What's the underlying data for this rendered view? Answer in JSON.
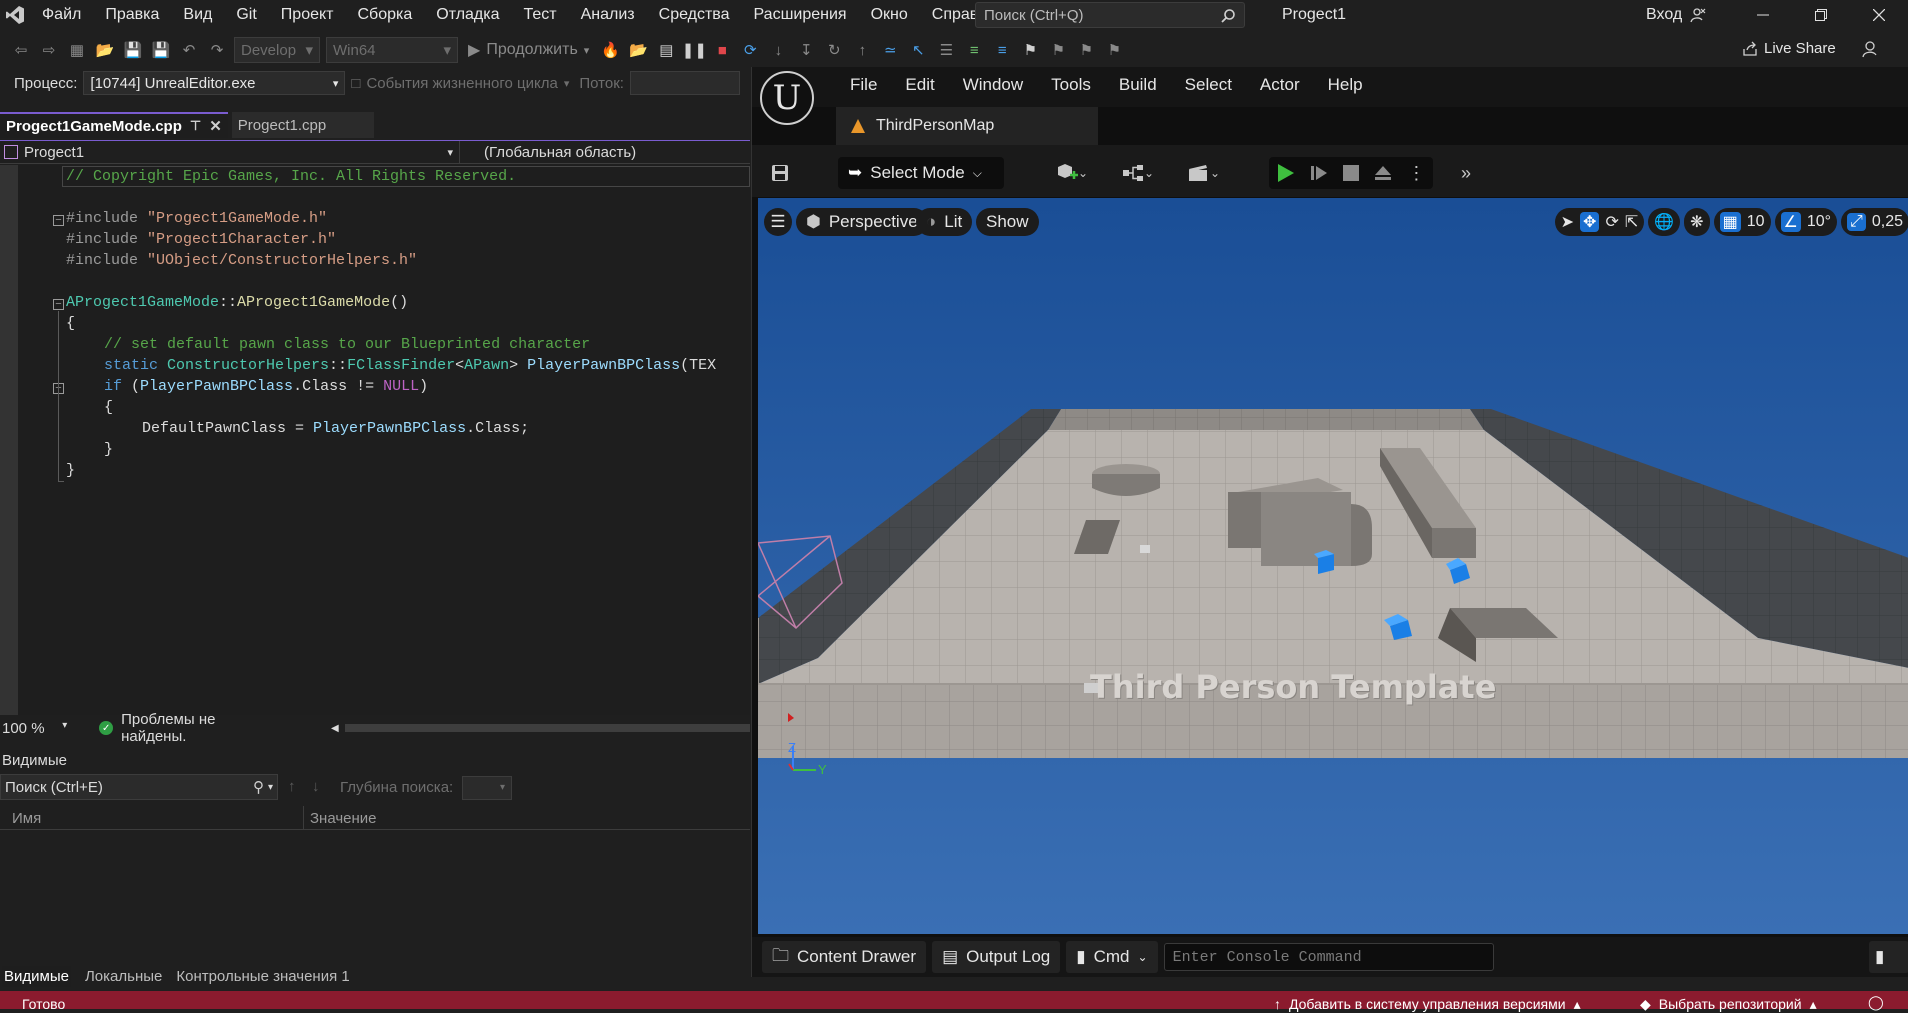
{
  "vs": {
    "menu": [
      "Файл",
      "Правка",
      "Вид",
      "Git",
      "Проект",
      "Сборка",
      "Отладка",
      "Тест",
      "Анализ",
      "Средства",
      "Расширения",
      "Окно",
      "Справка"
    ],
    "search_placeholder": "Поиск (Ctrl+Q)",
    "window_title": "Progect1",
    "login": "Вход",
    "toolbar": {
      "config": "Develop",
      "platform": "Win64",
      "continue": "Продолжить",
      "live_share": "Live Share"
    },
    "process": {
      "label": "Процесс:",
      "value": "[10744] UnrealEditor.exe",
      "lifecycle": "События жизненного цикла",
      "thread": "Поток:"
    },
    "tabs": [
      {
        "label": "Progect1GameMode.cpp"
      },
      {
        "label": "Progect1.cpp"
      }
    ],
    "navbar": {
      "project": "Progect1",
      "scope": "(Глобальная область)"
    },
    "code": {
      "copyright": "// Copyright Epic Games, Inc. All Rights Reserved.",
      "inc1_kw": "#include ",
      "inc1": "\"Progect1GameMode.h\"",
      "inc2_kw": "#include ",
      "inc2": "\"Progect1Character.h\"",
      "inc3_kw": "#include ",
      "inc3": "\"UObject/ConstructorHelpers.h\"",
      "ctor_class": "AProgect1GameMode",
      "ctor_sep": "::",
      "ctor_name": "AProgect1GameMode",
      "ctor_paren": "()",
      "brace_open": "{",
      "comment2": "// set default pawn class to our Blueprinted character",
      "static_kw": "static ",
      "helpers": "ConstructorHelpers",
      "sep2": "::",
      "finder": "FClassFinder",
      "lt": "<",
      "apawn": "APawn",
      "gt": "> ",
      "var": "PlayerPawnBPClass",
      "call": "(TEX",
      "if_kw": "if ",
      "if_open": "(",
      "if_var": "PlayerPawnBPClass",
      "if_class": ".Class != ",
      "if_null": "NULL",
      "if_close": ")",
      "brace2_open": "{",
      "assign_var": "DefaultPawnClass",
      "assign_eq": " = ",
      "assign_rhs": "PlayerPawnBPClass",
      "assign_end": ".Class;",
      "brace2_close": "}",
      "brace_close": "}"
    },
    "zoom": "100 %",
    "issues": "Проблемы не найдены.",
    "watch": {
      "title": "Видимые",
      "search": "Поиск (Ctrl+E)",
      "depth": "Глубина поиска:",
      "col_name": "Имя",
      "col_value": "Значение"
    },
    "bottom_tabs": [
      "Видимые",
      "Локальные",
      "Контрольные значения 1"
    ],
    "status": {
      "ready": "Готово",
      "add_vcs": "Добавить в систему управления версиями",
      "select_repo": "Выбрать репозиторий"
    }
  },
  "ue": {
    "menu": [
      "File",
      "Edit",
      "Window",
      "Tools",
      "Build",
      "Select",
      "Actor",
      "Help"
    ],
    "map_tab": "ThirdPersonMap",
    "select_mode": "Select Mode",
    "viewport": {
      "perspective": "Perspective",
      "lit": "Lit",
      "show": "Show",
      "grid_snap": "10",
      "rot_snap": "10°",
      "scale_snap": "0,25",
      "template_text": "Third Person Template",
      "axis_z": "Z",
      "axis_y": "Y"
    },
    "bottom": {
      "content_drawer": "Content Drawer",
      "output_log": "Output Log",
      "cmd": "Cmd",
      "console_placeholder": "Enter Console Command"
    }
  },
  "colors": {
    "vs_accent": "#7a5ccf",
    "status_bar": "#8b1b2e",
    "play_green": "#3fbf3f",
    "ue_blue": "#1a6fd0"
  }
}
